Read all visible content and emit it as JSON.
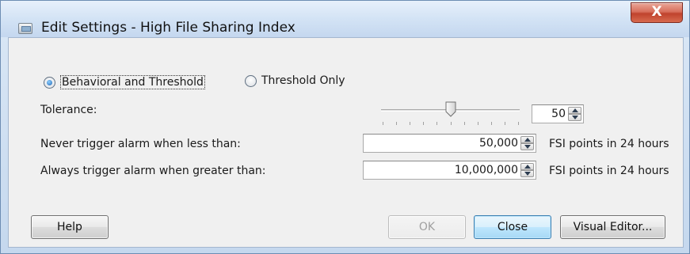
{
  "window": {
    "title": "Edit Settings - High File Sharing Index",
    "close_label": "X"
  },
  "mode": {
    "options": [
      {
        "label": "Behavioral and Threshold",
        "selected": true
      },
      {
        "label": "Threshold Only",
        "selected": false
      }
    ]
  },
  "tolerance": {
    "label": "Tolerance:",
    "value": "50",
    "slider_level": 50
  },
  "never_trigger": {
    "label": "Never trigger alarm when less than:",
    "value": "50,000",
    "unit": "FSI points in 24 hours"
  },
  "always_trigger": {
    "label": "Always trigger alarm when greater than:",
    "value": "10,000,000",
    "unit": "FSI points in 24 hours"
  },
  "buttons": {
    "help": "Help",
    "ok": "OK",
    "close": "Close",
    "visual_editor": "Visual Editor..."
  },
  "icons": {
    "app": "settings-window-icon",
    "spin_up": "arrow-up-icon",
    "spin_down": "arrow-down-icon"
  }
}
